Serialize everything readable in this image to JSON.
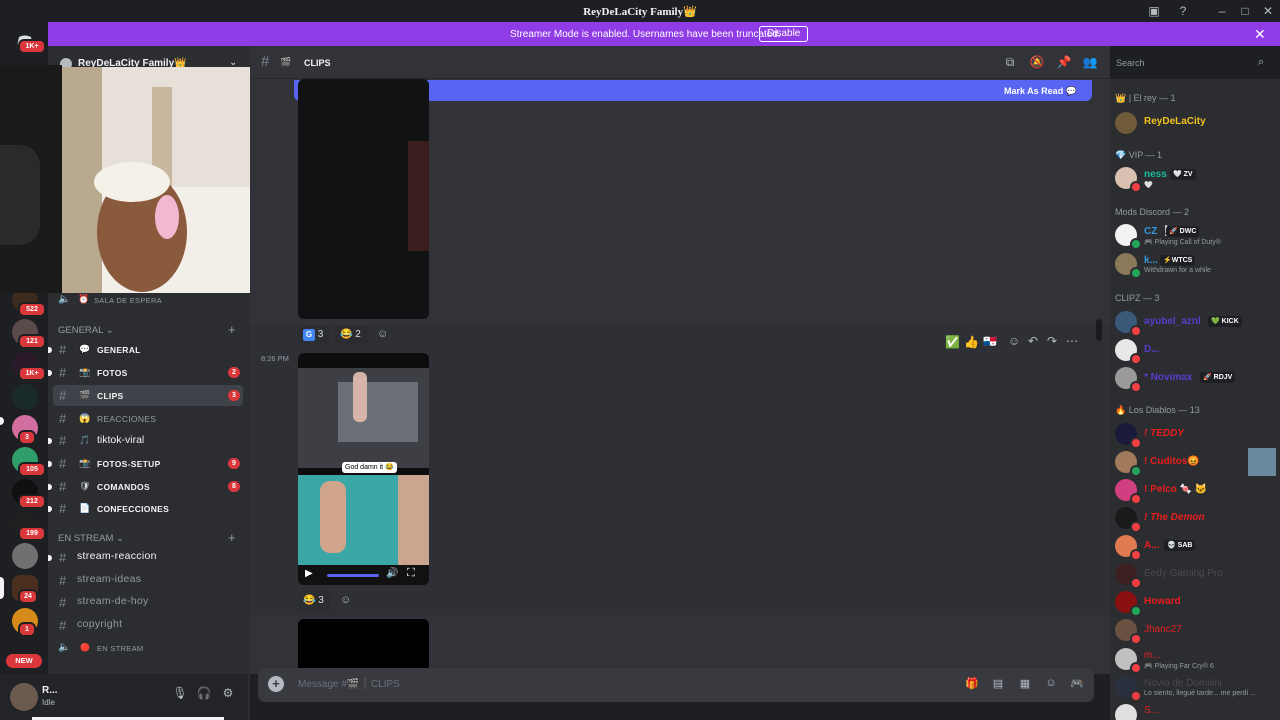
{
  "window": {
    "title": "ReyDeLaCity Family👑"
  },
  "banner": {
    "text": "Streamer Mode is enabled. Usernames have been truncated.",
    "button": "Disable"
  },
  "rail": {
    "badges": [
      "1K+",
      "1K+",
      "522",
      "121",
      "1K+",
      "3",
      "105",
      "212",
      "199",
      "24",
      "1"
    ],
    "new_label": "NEW"
  },
  "server": {
    "name": "ReyDeLaCity Family👑"
  },
  "sidebar": {
    "top_channel": {
      "emoji": "⏰",
      "name": "SALA DE ESPERA"
    },
    "categories": {
      "general": "GENERAL",
      "stream": "EN STREAM"
    },
    "general_channels": [
      {
        "emoji": "💬",
        "name": "GENERAL",
        "badge": ""
      },
      {
        "emoji": "📸",
        "name": "FOTOS",
        "badge": "2"
      },
      {
        "emoji": "🎬",
        "name": "CLIPS",
        "badge": "3"
      },
      {
        "emoji": "😱",
        "name": "REACCIONES",
        "badge": ""
      },
      {
        "emoji": "🎵",
        "name": "tiktok-viral",
        "badge": ""
      },
      {
        "emoji": "📸",
        "name": "FOTOS-SETUP",
        "badge": "9"
      },
      {
        "emoji": "🛡",
        "name": "COMANDOS",
        "badge": "8"
      },
      {
        "emoji": "📄",
        "name": "CONFECCIONES",
        "badge": ""
      }
    ],
    "stream_channels": [
      {
        "name": "stream-reaccion"
      },
      {
        "name": "stream-ideas"
      },
      {
        "name": "stream-de-hoy"
      },
      {
        "name": "copyright"
      }
    ],
    "voice_channel": {
      "emoji": "🔴",
      "name": "EN STREAM"
    }
  },
  "user": {
    "name": "R...",
    "status": "Idle"
  },
  "header": {
    "channel_emoji": "🎬",
    "channel_name": "CLIPS"
  },
  "search": {
    "placeholder": "Search"
  },
  "chat": {
    "mark_read": "Mark As Read",
    "reactions1": [
      {
        "emoji": "G",
        "count": "3"
      },
      {
        "emoji": "😂",
        "count": "2"
      }
    ],
    "message2": {
      "time": "8:26 PM",
      "video_caption": "God damn it 😂"
    },
    "reactions2": [
      {
        "emoji": "😂",
        "count": "3"
      }
    ],
    "hover_emojis": [
      "✅",
      "👍",
      "🇵🇦"
    ]
  },
  "composer": {
    "placeholder": "Message #🎬 ┆ CLIPS"
  },
  "members": {
    "groups": [
      {
        "label": "👑 | El rey — 1",
        "members": [
          {
            "name": "ReyDeLaCity",
            "color": "#f0c21b",
            "tag": "",
            "sub": ""
          }
        ]
      },
      {
        "label": "💎 VIP — 1",
        "members": [
          {
            "name": "ness",
            "color": "#1abc9c",
            "tag": "🤍 ZV",
            "sub": "🤍"
          }
        ]
      },
      {
        "label": "Mods Discord — 2",
        "members": [
          {
            "name": "CZ ❕",
            "color": "#3498db",
            "tag": "🚀 DWC",
            "sub": "🎮 Playing Call of Duty®"
          },
          {
            "name": "k...",
            "color": "#3498db",
            "tag": "⚡WTCS",
            "sub": "Withdrawn for a while"
          }
        ]
      },
      {
        "label": "CLIPZ — 3",
        "members": [
          {
            "name": "ayubel_aznl",
            "color": "#5b3ccc",
            "tag": "💚 KICK",
            "sub": ""
          },
          {
            "name": "D...",
            "color": "#5b3ccc",
            "tag": "",
            "sub": ""
          },
          {
            "name": "* Novimax",
            "color": "#5b3ccc",
            "tag": "🚀 RDJV",
            "sub": ""
          }
        ]
      },
      {
        "label": "🔥 Los Diablos — 13",
        "members": [
          {
            "name": "! TEDDY",
            "color": "#e91e1e",
            "tag": "",
            "sub": ""
          },
          {
            "name": "! Cuditos😡",
            "color": "#e91e1e",
            "tag": "",
            "sub": ""
          },
          {
            "name": "! Pelco 🍬 🐱",
            "color": "#e91e1e",
            "tag": "",
            "sub": ""
          },
          {
            "name": "! The Demon",
            "color": "#e91e1e",
            "tag": "",
            "sub": ""
          },
          {
            "name": "A...",
            "color": "#e91e1e",
            "tag": "💀 SAB",
            "sub": ""
          },
          {
            "name": "Eedy Gaming Pro",
            "color": "#3f3f3f",
            "tag": "",
            "sub": ""
          },
          {
            "name": "Howard",
            "color": "#e91e1e",
            "tag": "",
            "sub": ""
          },
          {
            "name": "Jhanc27",
            "color": "#e91e1e",
            "tag": "",
            "sub": ""
          },
          {
            "name": "m...",
            "color": "#e91e1e",
            "tag": "",
            "sub": "🎮 Playing Far Cry® 6"
          },
          {
            "name": "Novio de Domiiini",
            "color": "#3f3f3f",
            "tag": "",
            "sub": "Lo siento, llegué tarde... me perdí ..."
          },
          {
            "name": "S...",
            "color": "#e91e1e",
            "tag": "",
            "sub": ""
          }
        ]
      }
    ]
  },
  "colors": {
    "accent": "#5865f2",
    "banner": "#8f3be6",
    "mention_red": "#da373c"
  }
}
